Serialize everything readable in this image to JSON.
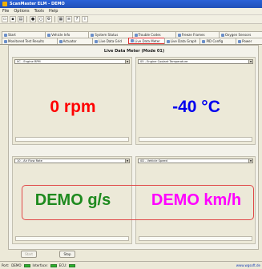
{
  "window": {
    "title": "ScanMaster ELM - DEMO"
  },
  "menu": [
    "File",
    "Options",
    "Tools",
    "Help"
  ],
  "toolbar": {
    "icons": [
      "open-icon",
      "save-icon",
      "print-icon",
      "connect-icon",
      "disconnect-icon",
      "settings-icon",
      "chart-icon",
      "log-icon",
      "help-icon",
      "info-icon"
    ]
  },
  "tabs_row1": [
    {
      "label": "Start",
      "icon": "start-icon"
    },
    {
      "label": "Vehicle Info",
      "icon": "vehicle-icon"
    },
    {
      "label": "System Status",
      "icon": "status-icon"
    },
    {
      "label": "Trouble Codes",
      "icon": "dtc-icon"
    },
    {
      "label": "Freeze Frames",
      "icon": "freeze-icon"
    },
    {
      "label": "Oxygen Sensors",
      "icon": "oxygen-icon"
    }
  ],
  "tabs_row2": [
    {
      "label": "Monitored Test Results",
      "icon": "monitor-icon"
    },
    {
      "label": "Actuator",
      "icon": "actuator-icon"
    },
    {
      "label": "Live Data Grid",
      "icon": "grid-icon"
    },
    {
      "label": "Live Data Meter",
      "icon": "meter-icon",
      "active": true
    },
    {
      "label": "Live Data Graph",
      "icon": "graph-icon"
    },
    {
      "label": "PID Config",
      "icon": "pid-icon"
    },
    {
      "label": "Power",
      "icon": "power-icon"
    }
  ],
  "panel": {
    "title": "Live Data Meter (Mode 01)"
  },
  "gauges": [
    {
      "pid": "0C - Engine RPM",
      "value": "0 rpm",
      "color": "#ff0000"
    },
    {
      "pid": "05 - Engine Coolant Temperature",
      "value": "-40 °C",
      "color": "#0000ee"
    },
    {
      "pid": "10 - Air Flow Rate",
      "value": "DEMO g/s",
      "color": "#1e8a1e"
    },
    {
      "pid": "0D - Vehicle Speed",
      "value": "DEMO km/h",
      "color": "#ff00ff"
    }
  ],
  "buttons": {
    "start": "Start",
    "stop": "Stop"
  },
  "status": {
    "port_label": "Port:",
    "port_value": "DEMO",
    "interface_label": "Interface:",
    "ecu_label": "ECU:",
    "link": "www.wgsoft.de"
  }
}
